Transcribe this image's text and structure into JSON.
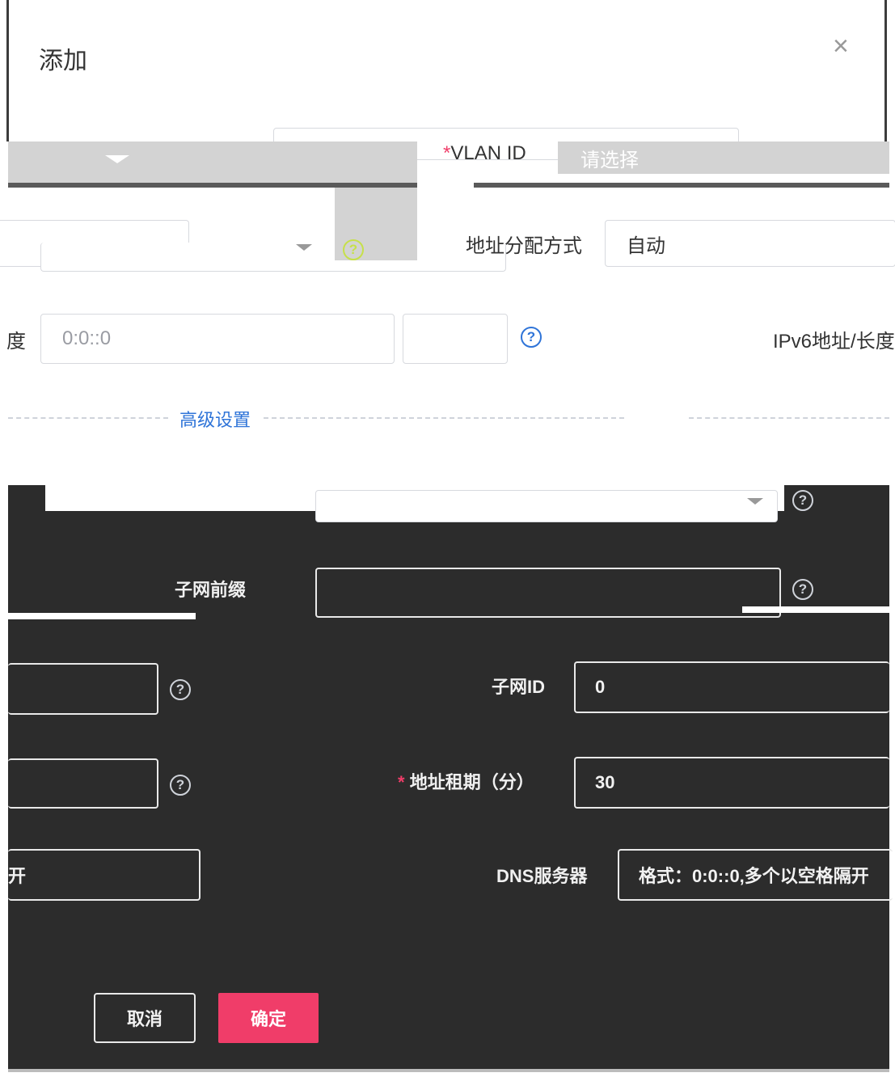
{
  "dialog": {
    "title": "添加",
    "close_label": "×"
  },
  "form": {
    "vlan_id": {
      "label": "VLAN ID",
      "required_mark": "*",
      "placeholder": "请选择"
    },
    "addr_mode": {
      "label": "地址分配方式",
      "value": "自动"
    },
    "ipv6_prefix": {
      "label_left": "度",
      "value": "0:0::0",
      "label_right": "IPv6地址/长度"
    },
    "advanced_label": "高级设置",
    "subnet_prefix": {
      "label": "子网前缀"
    },
    "subnet_id": {
      "label": "子网ID",
      "value": "0"
    },
    "lease": {
      "label": "地址租期（分）",
      "required_mark": "*",
      "value": "30"
    },
    "dns": {
      "label": "DNS服务器",
      "placeholder": "格式：0:0::0,多个以空格隔开"
    },
    "left_partial": "开",
    "help_glyph": "?"
  },
  "footer": {
    "cancel_label": "取消",
    "ok_label": "确定"
  },
  "colors": {
    "primary": "#f03d69",
    "link": "#2f74d8",
    "dark_bg": "#2c2c2c"
  }
}
